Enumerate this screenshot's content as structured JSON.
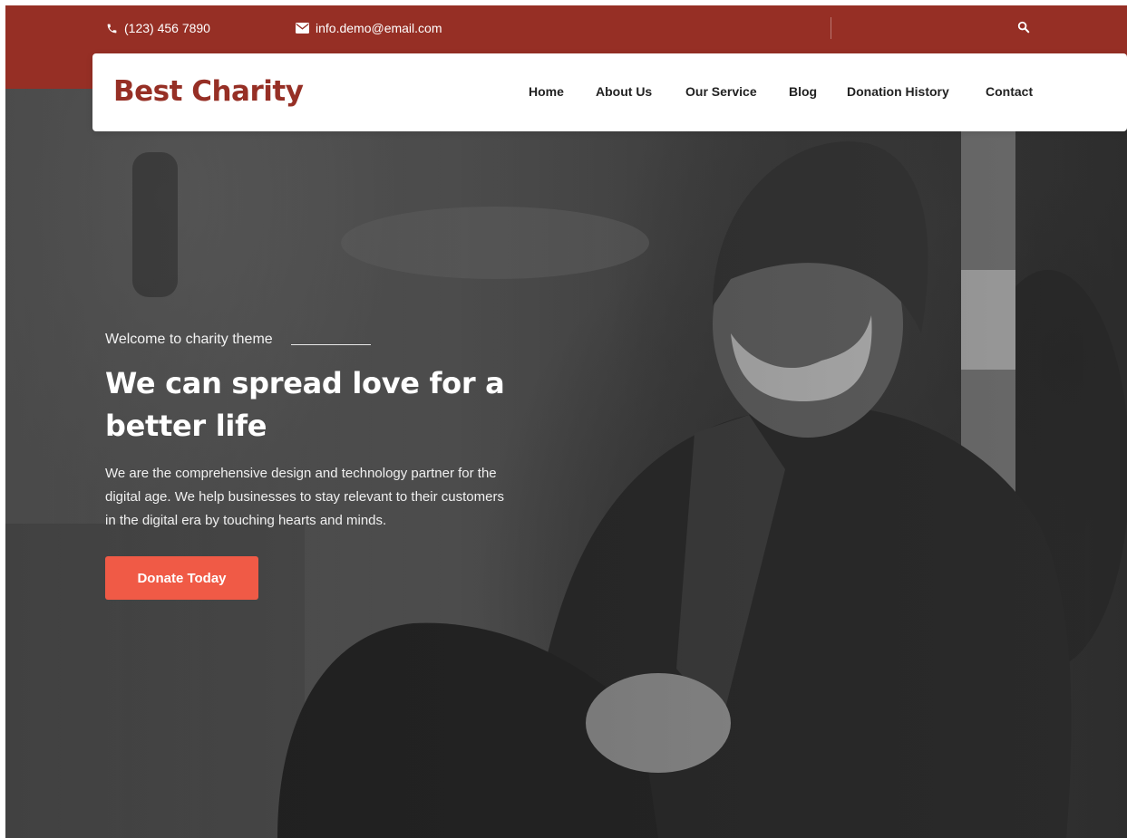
{
  "topbar": {
    "phone": "(123) 456 7890",
    "email": "info.demo@email.com",
    "phone_icon": "phone-icon",
    "email_icon": "envelope-icon",
    "search_icon": "search-icon"
  },
  "header": {
    "brand": "Best Charity",
    "nav": [
      {
        "label": "Home"
      },
      {
        "label": "About Us"
      },
      {
        "label": "Our Service"
      },
      {
        "label": "Blog"
      },
      {
        "label": "Donation History"
      },
      {
        "label": "Contact"
      }
    ]
  },
  "hero": {
    "welcome": "Welcome to charity theme",
    "headline_line1": "We can spread love for a",
    "headline_line2": "better life",
    "intro_line1": "We are the comprehensive design and technology partner for the",
    "intro_line2": "digital age. We help businesses to stay relevant to their customers",
    "intro_line3": "in the digital era by touching hearts and minds.",
    "cta_label": "Donate Today"
  },
  "colors": {
    "brand_red": "#962f25",
    "cta_coral": "#f05a46",
    "text_dark": "#222222"
  }
}
